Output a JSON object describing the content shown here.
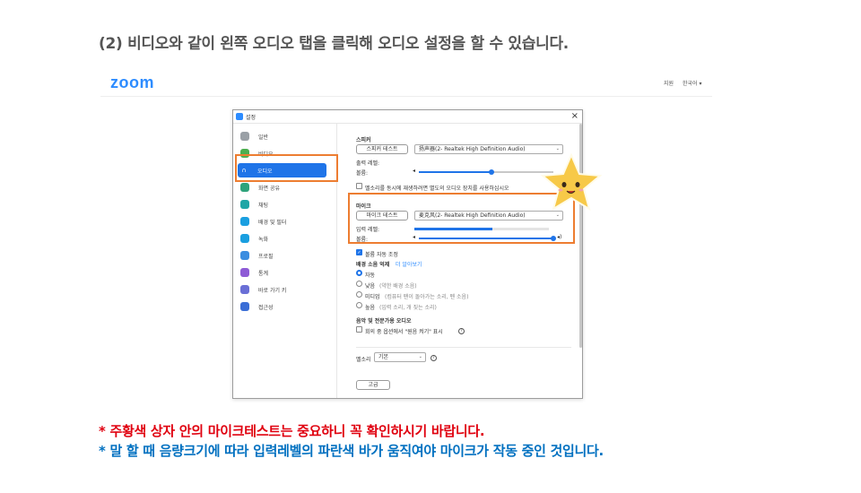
{
  "heading": "(2) 비디오와 같이 왼쪽 오디오 탭을 클릭해 오디오 설정을 할 수 있습니다.",
  "zoom_header": {
    "logo": "zoom",
    "support": "지원",
    "language": "한국어 ▾"
  },
  "window": {
    "title": "설정",
    "close": "×"
  },
  "sidebar": {
    "items": [
      {
        "label": "일반",
        "icon": "gear-icon",
        "color": "#9aa0a6"
      },
      {
        "label": "비디오",
        "icon": "video-icon",
        "color": "#4caf50"
      },
      {
        "label": "오디오",
        "icon": "headphones-icon",
        "color": "#1f74e8"
      },
      {
        "label": "화면 공유",
        "icon": "share-screen-icon",
        "color": "#2ea37b"
      },
      {
        "label": "채팅",
        "icon": "chat-icon",
        "color": "#1fa6a6"
      },
      {
        "label": "배경 및 필터",
        "icon": "background-icon",
        "color": "#1a9fe0"
      },
      {
        "label": "녹화",
        "icon": "record-icon",
        "color": "#1a9fe0"
      },
      {
        "label": "프로필",
        "icon": "profile-icon",
        "color": "#3b8de0"
      },
      {
        "label": "통계",
        "icon": "statistics-icon",
        "color": "#8e5bd6"
      },
      {
        "label": "바로 가기 키",
        "icon": "keyboard-icon",
        "color": "#6a6fd6"
      },
      {
        "label": "접근성",
        "icon": "accessibility-icon",
        "color": "#3b6ed6"
      }
    ],
    "active_index": 2
  },
  "audio": {
    "speaker_title": "스피커",
    "speaker_test": "스피커 테스트",
    "speaker_device": "扬声器(2- Realtek High Definition Audio)",
    "output_level": "출력 레벨:",
    "volume": "볼륨:",
    "separate_device": "벨소리를 동시에 재생하려면 별도의 오디오 장치를 사용하십시오",
    "mic_title": "마이크",
    "mic_test": "마이크 테스트",
    "mic_device": "麦克风(2- Realtek High Definition Audio)",
    "input_level": "입력 레벨:",
    "mic_volume": "볼륨:",
    "auto_adjust": "볼륨 자동 조정",
    "noise_title": "배경 소음 억제",
    "noise_link": "더 알아보기",
    "noise_options": [
      {
        "label": "자동",
        "hint": ""
      },
      {
        "label": "낮음",
        "hint": "(약한 배경 소음)"
      },
      {
        "label": "미디엄",
        "hint": "(컴퓨터 팬이 돌아가는 소리, 펜 소음)"
      },
      {
        "label": "높음",
        "hint": "(입력 소리, 개 짖는 소리)"
      }
    ],
    "noise_selected": 0,
    "music_title": "음악 및 전문가용 오디오",
    "original_sound": "회의 중 옵션에서 \"원음 켜기\" 표시",
    "ringtone_label": "벨소리",
    "ringtone_value": "기본",
    "advanced": "고급",
    "speaker_volume_fraction": 0.54,
    "mic_volume_fraction": 1.0,
    "input_level_fraction": 0.58
  },
  "notes": {
    "red": "* 주황색 상자 안의 마이크테스트는 중요하니 꼭 확인하시기 바랍니다.",
    "blue": "* 말 할 때 음량크기에 따라 입력레벨의 파란색 바가 움직여야 마이크가 작동 중인 것입니다."
  },
  "colors": {
    "highlight": "#ed7d31",
    "accent": "#1f74e8",
    "note_red": "#e0000f",
    "note_blue": "#0070c0"
  }
}
